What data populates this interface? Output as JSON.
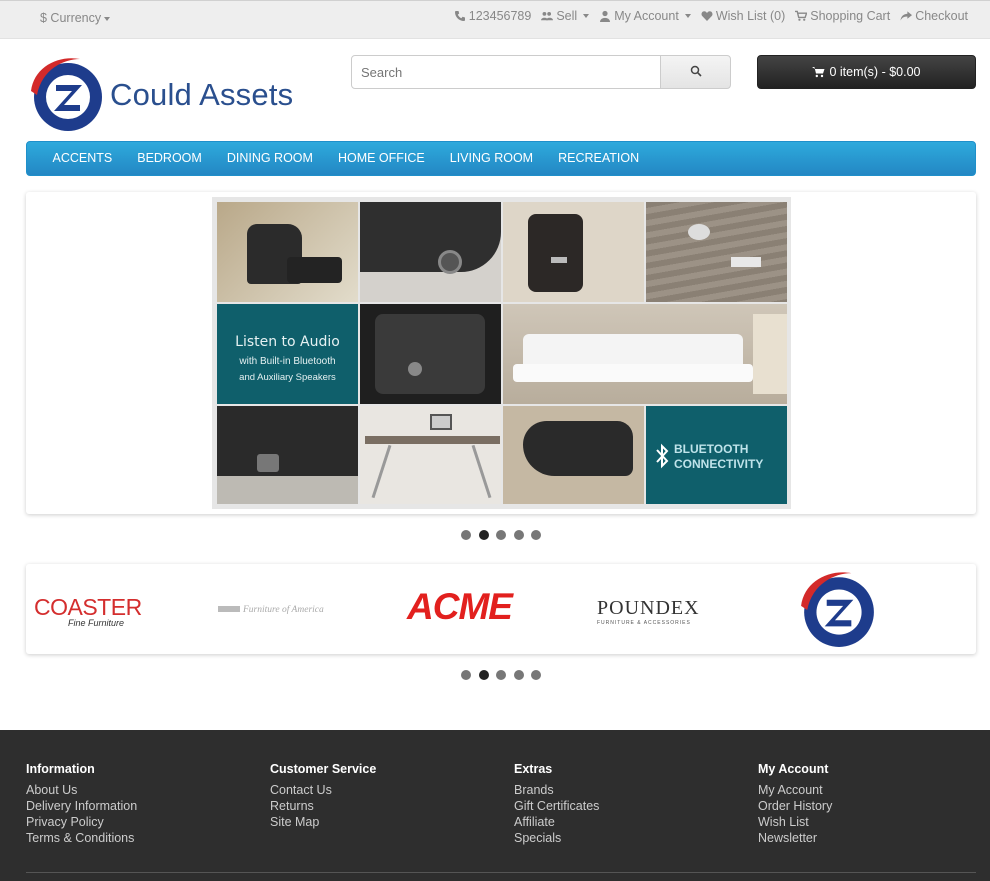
{
  "topbar": {
    "currency_label": "$ Currency",
    "phone": "123456789",
    "sell": "Sell",
    "my_account": "My Account",
    "wish_list": "Wish List (0)",
    "shopping_cart": "Shopping Cart",
    "checkout": "Checkout"
  },
  "header": {
    "logo_text": "Could Assets",
    "search_placeholder": "Search",
    "cart_label": "0 item(s) - $0.00"
  },
  "menu": [
    "ACCENTS",
    "BEDROOM",
    "DINING ROOM",
    "HOME OFFICE",
    "LIVING ROOM",
    "RECREATION"
  ],
  "slideshow": {
    "text1_line1": "Listen to Audio",
    "text1_line2": "with Built-in Bluetooth",
    "text1_line3": "and Auxiliary Speakers",
    "text2_line1": "BLUETOOTH",
    "text2_line2": "CONNECTIVITY",
    "dots": 5,
    "active_dot": 1
  },
  "brands": {
    "coaster": "COASTER",
    "coaster_sub": "Fine Furniture",
    "foa": "Furniture of America",
    "acme": "ACME",
    "poundex": "POUNDEX",
    "poundex_sub": "FURNITURE & ACCESSORIES",
    "dots": 5,
    "active_dot": 1
  },
  "footer": {
    "information": {
      "title": "Information",
      "links": [
        "About Us",
        "Delivery Information",
        "Privacy Policy",
        "Terms & Conditions"
      ]
    },
    "customer_service": {
      "title": "Customer Service",
      "links": [
        "Contact Us",
        "Returns",
        "Site Map"
      ]
    },
    "extras": {
      "title": "Extras",
      "links": [
        "Brands",
        "Gift Certificates",
        "Affiliate",
        "Specials"
      ]
    },
    "my_account": {
      "title": "My Account",
      "links": [
        "My Account",
        "Order History",
        "Wish List",
        "Newsletter"
      ]
    }
  },
  "colors": {
    "menu": "#2a9bd3",
    "logo_blue": "#1e3c8c",
    "logo_red": "#d32a2a",
    "teal": "#0f5f6b",
    "footer": "#2e2e2e"
  }
}
